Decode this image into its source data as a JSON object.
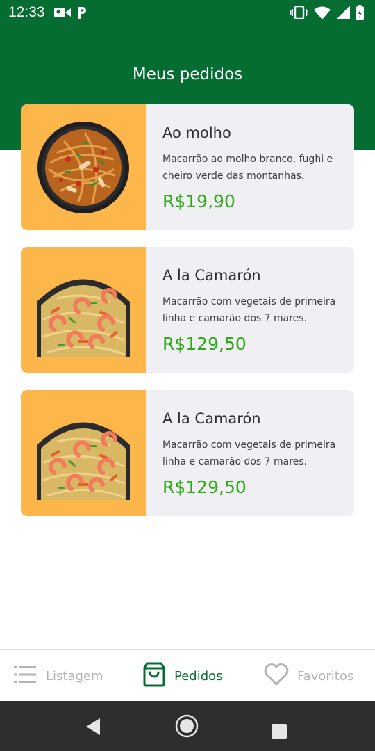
{
  "status_bar": {
    "time": "12:33",
    "left_icons": [
      "video-camera-icon",
      "parking-icon"
    ],
    "right_icons": [
      "vibrate-icon",
      "wifi-icon",
      "signal-icon",
      "battery-icon"
    ]
  },
  "header": {
    "title": "Meus pedidos",
    "color": "#066d32"
  },
  "orders": [
    {
      "name": "Ao molho",
      "description": "Macarrão ao molho branco, fughi e cheiro verde das montanhas.",
      "price": "R$19,90",
      "image": "pasta-bowl-image"
    },
    {
      "name": "A la Camarón",
      "description": "Macarrão com vegetais de primeira linha e camarão dos 7 mares.",
      "price": "R$129,50",
      "image": "shrimp-noodles-image"
    },
    {
      "name": "A la Camarón",
      "description": "Macarrão com vegetais de primeira linha e camarão dos 7 mares.",
      "price": "R$129,50",
      "image": "shrimp-noodles-image"
    }
  ],
  "bottom_nav": {
    "items": [
      {
        "label": "Listagem",
        "icon": "list-icon",
        "active": false
      },
      {
        "label": "Pedidos",
        "icon": "shopping-bag-icon",
        "active": true
      },
      {
        "label": "Favoritos",
        "icon": "heart-icon",
        "active": false
      }
    ]
  },
  "colors": {
    "accent": "#066d32",
    "price": "#2eab17",
    "thumb_bg": "#fdb64a",
    "card_bg": "#efeff4"
  }
}
